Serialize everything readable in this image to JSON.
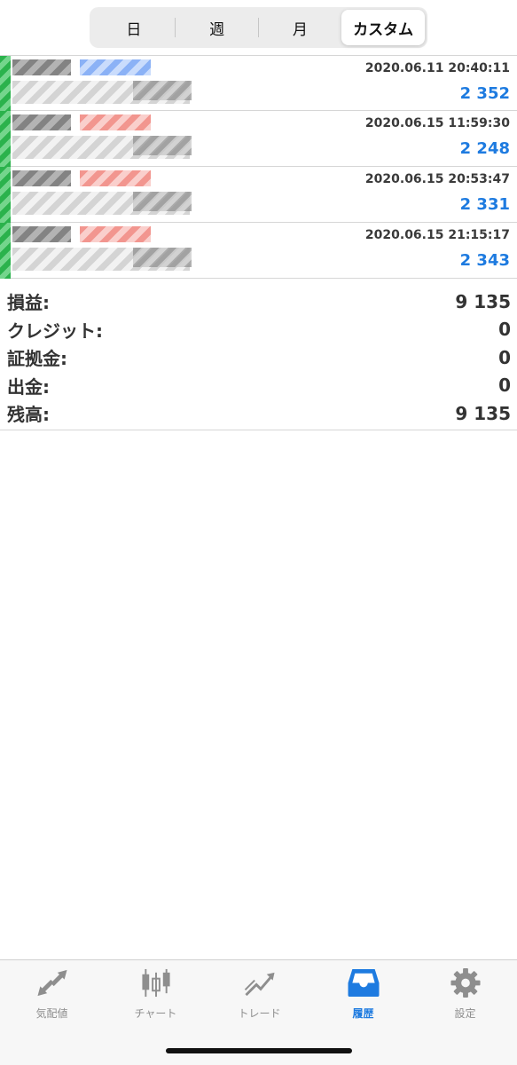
{
  "period_tabs": [
    {
      "label": "日",
      "active": false
    },
    {
      "label": "週",
      "active": false
    },
    {
      "label": "月",
      "active": false
    },
    {
      "label": "カスタム",
      "active": true
    }
  ],
  "trades": [
    {
      "datetime": "2020.06.11 20:40:11",
      "profit": "2 352",
      "side_color": "blue"
    },
    {
      "datetime": "2020.06.15 11:59:30",
      "profit": "2 248",
      "side_color": "red"
    },
    {
      "datetime": "2020.06.15 20:53:47",
      "profit": "2 331",
      "side_color": "red"
    },
    {
      "datetime": "2020.06.15 21:15:17",
      "profit": "2 343",
      "side_color": "red"
    }
  ],
  "summary": [
    {
      "label": "損益:",
      "value": "9 135"
    },
    {
      "label": "クレジット:",
      "value": "0"
    },
    {
      "label": "証拠金:",
      "value": "0"
    },
    {
      "label": "出金:",
      "value": "0"
    },
    {
      "label": "残高:",
      "value": "9 135"
    }
  ],
  "tabbar": [
    {
      "label": "気配値",
      "icon": "quotes-arrows-icon",
      "active": false
    },
    {
      "label": "チャート",
      "icon": "candlestick-icon",
      "active": false
    },
    {
      "label": "トレード",
      "icon": "trade-trend-icon",
      "active": false
    },
    {
      "label": "履歴",
      "icon": "history-inbox-icon",
      "active": true
    },
    {
      "label": "設定",
      "icon": "gear-icon",
      "active": false
    }
  ],
  "colors": {
    "accent": "#1e7be0",
    "inactive_icon": "#8e8e8e",
    "profit": "#1e7be0"
  }
}
